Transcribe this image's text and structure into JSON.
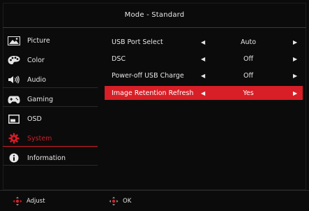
{
  "header": {
    "title": "Mode - Standard"
  },
  "sidebar": {
    "items": [
      {
        "label": "Picture",
        "icon": "picture-icon"
      },
      {
        "label": "Color",
        "icon": "palette-icon"
      },
      {
        "label": "Audio",
        "icon": "speaker-icon"
      },
      {
        "label": "Gaming",
        "icon": "gamepad-icon"
      },
      {
        "label": "OSD",
        "icon": "osd-window-icon"
      },
      {
        "label": "System",
        "icon": "gear-icon"
      },
      {
        "label": "Information",
        "icon": "info-icon"
      }
    ],
    "active_index": 5
  },
  "settings": {
    "rows": [
      {
        "label": "USB Port Select",
        "value": "Auto"
      },
      {
        "label": "DSC",
        "value": "Off"
      },
      {
        "label": "Power-off USB Charge",
        "value": "Off"
      },
      {
        "label": "Image Retention Refresh",
        "value": "Yes"
      }
    ],
    "selected_index": 3
  },
  "footer": {
    "adjust_label": "Adjust",
    "ok_label": "OK"
  },
  "colors": {
    "accent": "#d81e26",
    "background": "#0b0b0b",
    "text": "#e6e6e6"
  }
}
